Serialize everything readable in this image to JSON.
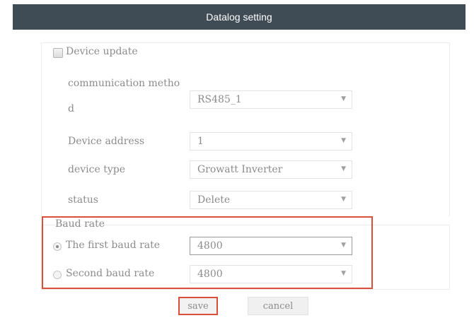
{
  "window": {
    "title": "Datalog setting"
  },
  "device_update": {
    "label": "Device update",
    "checked": false
  },
  "fields": {
    "comm_method": {
      "label_line1": "communication metho",
      "label_line2": "d",
      "value": "RS485_1"
    },
    "device_address": {
      "label": "Device address",
      "value": "1"
    },
    "device_type": {
      "label": "device type",
      "value": "Growatt Inverter"
    },
    "status": {
      "label": "status",
      "value": "Delete"
    }
  },
  "baud": {
    "title": "Baud rate",
    "first": {
      "label": "The first baud rate",
      "value": "4800",
      "selected": true
    },
    "second": {
      "label": "Second baud rate",
      "value": "4800",
      "selected": false
    }
  },
  "buttons": {
    "save": "save",
    "cancel": "cancel"
  },
  "icons": {
    "dropdown": "chevron-down-icon"
  },
  "colors": {
    "titlebar": "#3f4b55",
    "highlight": "#d94f3b"
  }
}
